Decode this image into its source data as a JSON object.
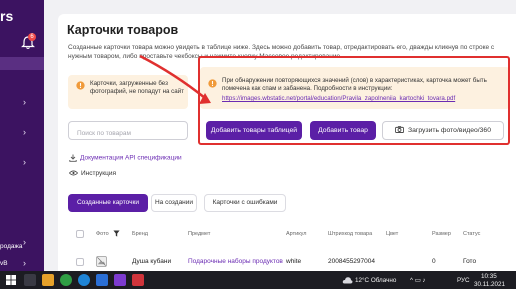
{
  "sidebar": {
    "brand": "rs",
    "notifications_count": "6",
    "bottom_item": "родажа",
    "bottom_item2": "vB"
  },
  "page": {
    "title": "Карточки товаров",
    "description": "Созданные карточки товара можно увидеть в таблице ниже. Здесь можно добавить товар, отредактировать его, дважды кликнув по строке с нужным товаром, либо проставьте чекбоксы и нажмите кнопку Массовое редактирование."
  },
  "notices": {
    "left": "Карточки, загруженные без фотографий, не попадут на сайт",
    "right": "При обнаружении повторяющихся значений (слов) в характеристиках, карточка может быть помечена как спам и забанена. Подробности в инструкции:",
    "right_link": "https://images.wbstatic.net/portal/education/Pravila_zapolneniia_kartochki_tovara.pdf"
  },
  "search": {
    "placeholder": "Поиск по товарам"
  },
  "buttons": {
    "add_table": "Добавить товары таблицей",
    "add_product": "Добавить товар",
    "upload_media": "Загрузить фото/видео/360"
  },
  "links": {
    "api_docs": "Документация API спецификации",
    "instruction": "Инструкция"
  },
  "tabs": [
    "Созданные карточки",
    "На создании",
    "Карточки с ошибками"
  ],
  "table": {
    "headers": {
      "photo": "Фото",
      "brand": "Бренд",
      "subject": "Предмет",
      "article": "Артикул",
      "barcode": "Штрихкод товара",
      "color": "Цвет",
      "size": "Размер",
      "status": "Статус"
    },
    "row": {
      "brand": "Душа кубани",
      "subject": "Подарочные наборы продуктов",
      "article": "white",
      "barcode": "2008455297004",
      "size": "0",
      "status": "Гото"
    }
  },
  "taskbar": {
    "weather": "12°C Облачно",
    "lang": "РУС",
    "time": "10:35",
    "date": "30.11.2021"
  },
  "colors": {
    "sidebar": "#3c1361",
    "primary": "#5b1fa6",
    "notice_bg": "#fdf1e0",
    "annotation": "#e0302f"
  }
}
